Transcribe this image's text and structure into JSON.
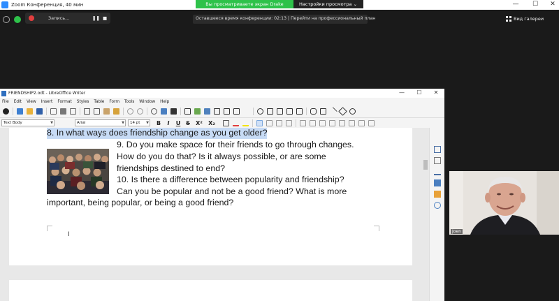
{
  "zoom": {
    "window_title": "Zoom Конференция, 40 мин",
    "share_banner": "Вы просматриваете экран Drake Lang",
    "view_options": "Настройки просмотра",
    "view_options_chevron": "⌄",
    "recording_label": "Запись...",
    "pause_glyph": "❚❚",
    "stop_glyph": "■",
    "timer_text": "Оставшееся время конференции: 02:13 | Перейти на профессиональный план",
    "gallery_label": "Вид галереи",
    "minimize_glyph": "—",
    "maximize_glyph": "☐",
    "close_glyph": "✕"
  },
  "libreoffice": {
    "window_title": "FRIENDSHIP2.odt - LibreOffice Writer",
    "menu": [
      "File",
      "Edit",
      "View",
      "Insert",
      "Format",
      "Styles",
      "Table",
      "Form",
      "Tools",
      "Window",
      "Help"
    ],
    "paragraph_style": "Text Body",
    "font_name": "Arial",
    "font_size": "14 pt",
    "format_buttons": [
      "B",
      "I",
      "U",
      "S",
      "X²",
      "X₂"
    ],
    "minimize_glyph": "—",
    "maximize_glyph": "☐",
    "close_glyph": "✕"
  },
  "document": {
    "lines": [
      "8. In what ways does friendship change as you get older?",
      "9. Do you make space for their friends to go through changes.",
      "How do you do that? Is it always possible, or are some",
      "friendships destined to end?",
      "10. Is there a difference between popularity and friendship?",
      "Can you be popular and not be a good friend? What is more",
      "important, being popular, or being a good friend?"
    ]
  },
  "webcam": {
    "participant_label": "Joen"
  }
}
